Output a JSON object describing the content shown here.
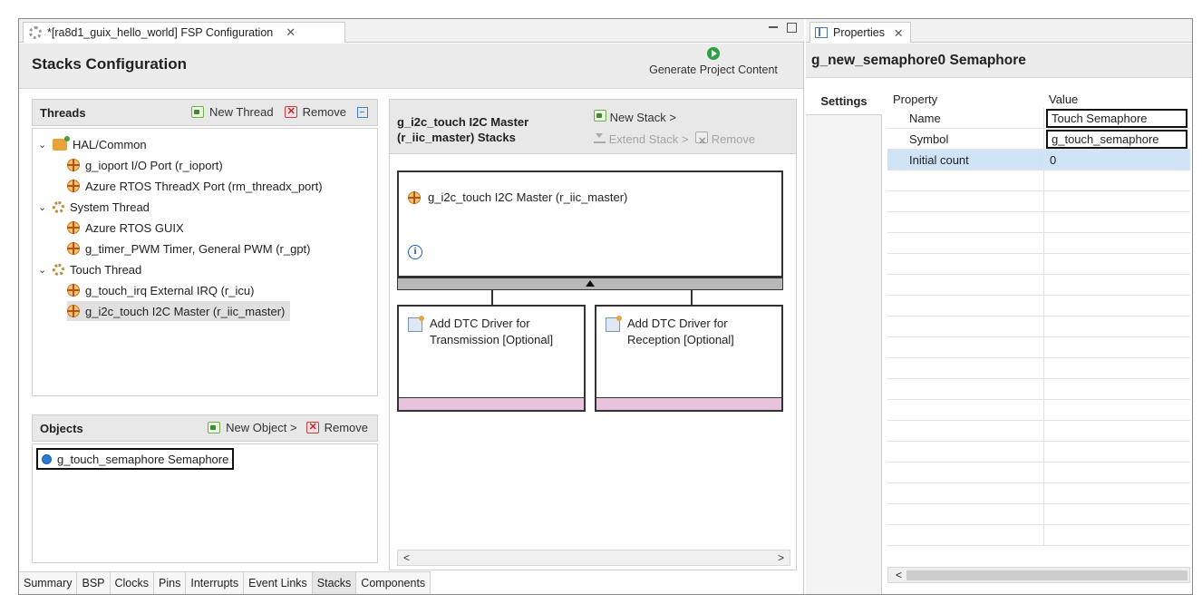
{
  "editor": {
    "tab_title": "*[ra8d1_guix_hello_world] FSP Configuration",
    "tab_close": "✕",
    "header_title": "Stacks Configuration",
    "generate_label": "Generate Project Content"
  },
  "threads": {
    "title": "Threads",
    "new_thread": "New Thread",
    "remove": "Remove",
    "tree": [
      {
        "label": "HAL/Common",
        "chev": "⌄"
      },
      {
        "label": "g_ioport I/O Port (r_ioport)"
      },
      {
        "label": "Azure RTOS ThreadX Port (rm_threadx_port)"
      },
      {
        "label": "System Thread",
        "chev": "⌄"
      },
      {
        "label": "Azure RTOS GUIX"
      },
      {
        "label": "g_timer_PWM Timer, General PWM (r_gpt)"
      },
      {
        "label": "Touch Thread",
        "chev": "⌄"
      },
      {
        "label": "g_touch_irq External IRQ (r_icu)"
      },
      {
        "label": "g_i2c_touch I2C Master (r_iic_master)"
      }
    ]
  },
  "objects": {
    "title": "Objects",
    "new_object": "New Object >",
    "remove": "Remove",
    "items": [
      {
        "label": "g_touch_semaphore Semaphore"
      }
    ]
  },
  "stacks": {
    "title_line1": "g_i2c_touch I2C Master",
    "title_line2": "(r_iic_master) Stacks",
    "new_stack": "New Stack >",
    "extend_stack": "Extend Stack >",
    "remove": "Remove",
    "main_module": "g_i2c_touch I2C Master (r_iic_master)",
    "info_glyph": "i",
    "dependencies": [
      {
        "line1": "Add DTC Driver for",
        "line2": "Transmission [Optional]"
      },
      {
        "line1": "Add DTC Driver for",
        "line2": "Reception [Optional]"
      }
    ],
    "scroll_left": "<",
    "scroll_right": ">"
  },
  "bottom_tabs": [
    "Summary",
    "BSP",
    "Clocks",
    "Pins",
    "Interrupts",
    "Event Links",
    "Stacks",
    "Components"
  ],
  "active_bottom_tab": "Stacks",
  "properties": {
    "tab_title": "Properties",
    "tab_close": "✕",
    "header_title": "g_new_semaphore0 Semaphore",
    "settings_tab": "Settings",
    "col_property": "Property",
    "col_value": "Value",
    "rows": [
      {
        "name": "Name",
        "value": "Touch Semaphore"
      },
      {
        "name": "Symbol",
        "value": "g_touch_semaphore"
      },
      {
        "name": "Initial count",
        "value": "0"
      }
    ],
    "scroll_left": "<"
  },
  "colors": {
    "selected_row": "#cfe4f7",
    "dependency_footer": "#e8c3de",
    "generate_icon": "#2f9e44"
  }
}
